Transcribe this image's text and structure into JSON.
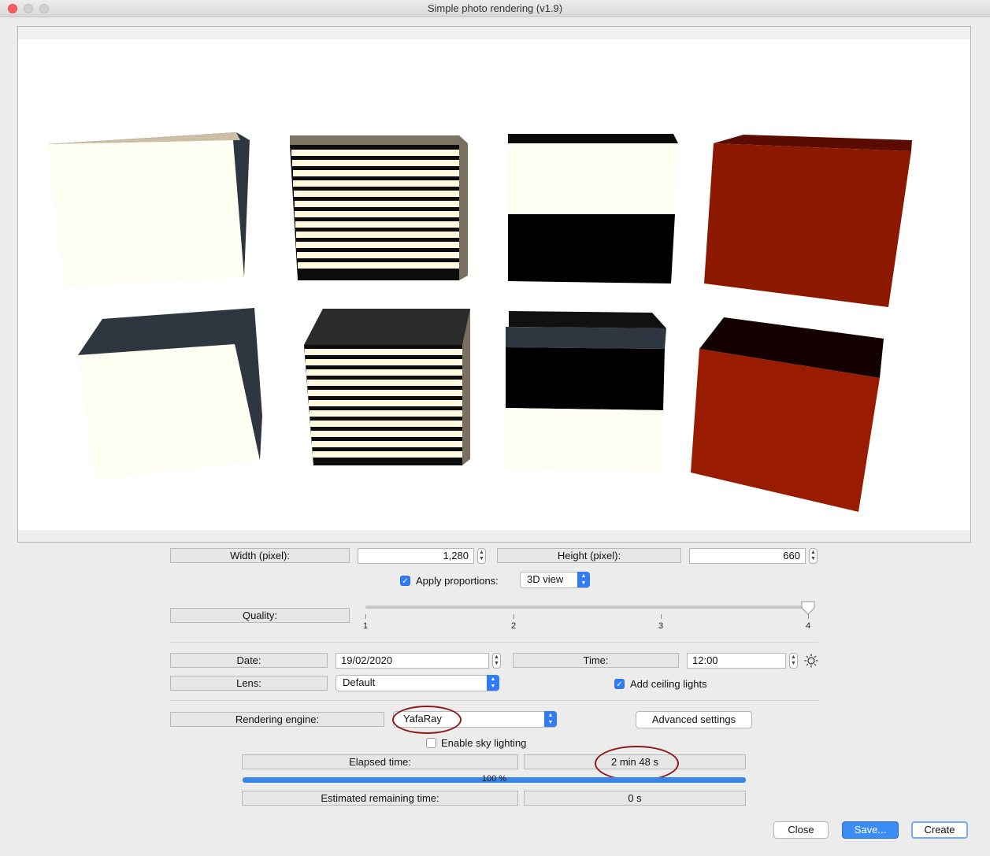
{
  "window": {
    "title": "Simple photo rendering (v1.9)"
  },
  "size": {
    "width_label": "Width (pixel):",
    "width_value": "1,280",
    "height_label": "Height (pixel):",
    "height_value": "660"
  },
  "proportions": {
    "label": "Apply proportions:",
    "checked": true,
    "select_value": "3D view"
  },
  "quality": {
    "label": "Quality:",
    "ticks": [
      "1",
      "2",
      "3",
      "4"
    ],
    "value": 4
  },
  "date": {
    "label": "Date:",
    "value": "19/02/2020"
  },
  "time": {
    "label": "Time:",
    "value": "12:00"
  },
  "lens": {
    "label": "Lens:",
    "value": "Default"
  },
  "ceiling": {
    "label": "Add ceiling lights",
    "checked": true
  },
  "engine": {
    "label": "Rendering engine:",
    "value": "YafaRay",
    "advanced_label": "Advanced settings"
  },
  "sky": {
    "label": "Enable sky lighting",
    "checked": false
  },
  "elapsed": {
    "label": "Elapsed time:",
    "value": "2 min 48 s"
  },
  "progress": {
    "text": "100 %",
    "fraction": 1.0
  },
  "remaining": {
    "label": "Estimated remaining time:",
    "value": "0 s"
  },
  "buttons": {
    "close": "Close",
    "save": "Save...",
    "create": "Create"
  },
  "colors": {
    "accent": "#2f7cf6",
    "cube_cream": "#fffef2",
    "cube_dark": "#2e3640",
    "cube_red": "#8c1800",
    "annotation": "#8b1a1a"
  }
}
